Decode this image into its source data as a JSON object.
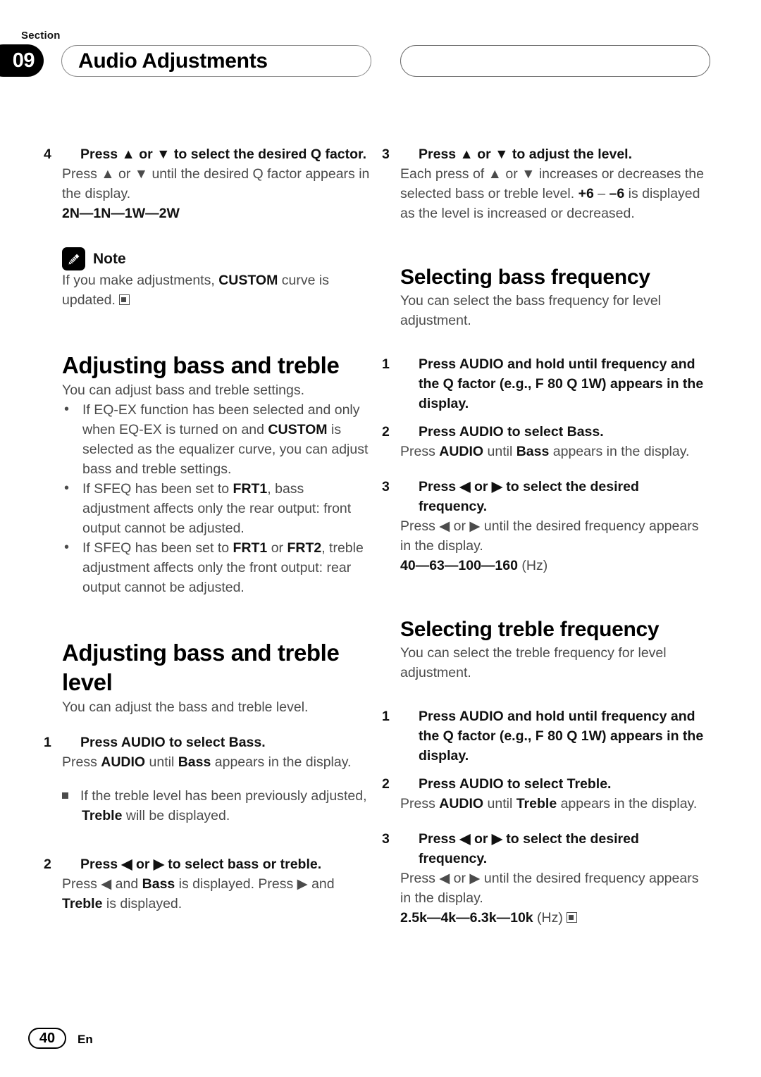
{
  "header": {
    "section_word": "Section",
    "section_number": "09",
    "title": "Audio Adjustments"
  },
  "left_column": {
    "step4": {
      "num": "4",
      "text": "Press ▲ or ▼ to select the desired Q factor."
    },
    "step4_body": "Press ▲ or ▼ until the desired Q factor appears in the display.",
    "q_factor_values": "2N—1N—1W—2W",
    "note": {
      "label": "Note",
      "icon": "pencil-icon",
      "text_before": "If you make adjustments, ",
      "keyword": "CUSTOM",
      "text_after": " curve is updated."
    },
    "heading_bass_treble": "Adjusting bass and treble",
    "intro_bass_treble": "You can adjust bass and treble settings.",
    "bullets": [
      {
        "part1": "If EQ-EX function has been selected and only when EQ-EX is turned on and ",
        "kw": "CUSTOM",
        "part2": " is selected as the equalizer curve, you can adjust bass and treble settings."
      },
      {
        "part1": "If SFEQ has been set to ",
        "kw": "FRT1",
        "part2": ", bass adjustment affects only the rear output: front output cannot be adjusted."
      },
      {
        "part1": "If SFEQ has been set to ",
        "kw": "FRT1",
        "mid": " or ",
        "kw2": "FRT2",
        "part2": ", treble adjustment affects only the front output: rear output cannot be adjusted."
      }
    ],
    "heading_bass_treble_level": "Adjusting bass and treble level",
    "intro_bass_treble_level": "You can adjust the bass and treble level.",
    "step1": {
      "num": "1",
      "text": "Press AUDIO to select Bass."
    },
    "step1_body_pre": "Press ",
    "step1_body_kw1": "AUDIO",
    "step1_body_mid": " until ",
    "step1_body_kw2": "Bass",
    "step1_body_post": " appears in the display.",
    "step1_sq_pre": "If the treble level has been previously adjusted, ",
    "step1_sq_kw": "Treble",
    "step1_sq_post": " will be displayed.",
    "step2": {
      "num": "2",
      "text": "Press ◀ or ▶ to select bass or treble."
    },
    "step2_body_pre": "Press ◀ and ",
    "step2_body_kw1": "Bass",
    "step2_body_mid": " is displayed. Press ▶ and ",
    "step2_body_kw2": "Treble",
    "step2_body_post": " is displayed."
  },
  "right_column": {
    "step3": {
      "num": "3",
      "text": "Press ▲ or ▼ to adjust the level."
    },
    "step3_body_pre": "Each press of ▲ or ▼ increases or decreases the selected bass or treble level. ",
    "step3_body_kw1": "+6",
    "step3_body_mid": " – ",
    "step3_body_kw2": "–6",
    "step3_body_post": " is displayed as the level is increased or decreased.",
    "heading_bass_freq": "Selecting bass frequency",
    "intro_bass_freq": "You can select the bass frequency for level adjustment.",
    "bass_step1": {
      "num": "1",
      "text": "Press AUDIO and hold until frequency and the Q factor (e.g., F 80 Q 1W) appears in the display."
    },
    "bass_step2": {
      "num": "2",
      "text": "Press AUDIO to select Bass."
    },
    "bass_step2_body_pre": "Press ",
    "bass_step2_body_kw1": "AUDIO",
    "bass_step2_body_mid": " until ",
    "bass_step2_body_kw2": "Bass",
    "bass_step2_body_post": " appears in the display.",
    "bass_step3": {
      "num": "3",
      "text": "Press ◀ or ▶ to select the desired frequency."
    },
    "bass_step3_body": "Press ◀ or ▶ until the desired frequency appears in the display.",
    "bass_values": "40—63—100—160",
    "bass_values_unit": " (Hz)",
    "heading_treble_freq": "Selecting treble frequency",
    "intro_treble_freq": "You can select the treble frequency for level adjustment.",
    "treble_step1": {
      "num": "1",
      "text": "Press AUDIO and hold until frequency and the Q factor (e.g., F 80 Q 1W) appears in the display."
    },
    "treble_step2": {
      "num": "2",
      "text": "Press AUDIO to select Treble."
    },
    "treble_step2_body_pre": "Press ",
    "treble_step2_body_kw1": "AUDIO",
    "treble_step2_body_mid": " until ",
    "treble_step2_body_kw2": "Treble",
    "treble_step2_body_post": " appears in the display.",
    "treble_step3": {
      "num": "3",
      "text": "Press ◀ or ▶ to select the desired frequency."
    },
    "treble_step3_body": "Press ◀ or ▶ until the desired frequency appears in the display.",
    "treble_values": "2.5k—4k—6.3k—10k",
    "treble_values_unit": " (Hz)"
  },
  "footer": {
    "page_number": "40",
    "language": "En"
  }
}
